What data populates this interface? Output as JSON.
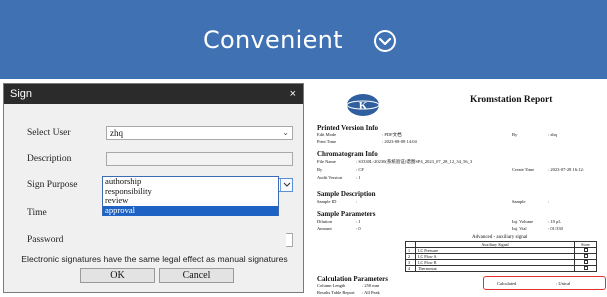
{
  "banner": {
    "title": "Convenient",
    "icon": "chevron-down-circle-icon",
    "background": "#3f71b3"
  },
  "dialog": {
    "title": "Sign",
    "close_icon": "×",
    "fields": {
      "select_user": {
        "label": "Select User",
        "value": "zhq"
      },
      "description": {
        "label": "Description",
        "value": ""
      },
      "sign_purpose": {
        "label": "Sign Purpose",
        "value": "authorship"
      },
      "time": {
        "label": "Time"
      },
      "password": {
        "label": "Password"
      }
    },
    "sign_purpose_options": [
      "authorship",
      "responsibility",
      "review",
      "approval"
    ],
    "highlighted_option": "approval",
    "note": "Electronic signatures have the same legal effect as manual signatures",
    "ok_label": "OK",
    "cancel_label": "Cancel"
  },
  "report": {
    "title": "Kromstation Report",
    "sections": {
      "printed": "Printed Version Info",
      "chromatogram": "Chromatogram Info",
      "sample_desc": "Sample Description",
      "sample_params": "Sample Parameters",
      "calc_params": "Calculation Parameters"
    },
    "printed_rows": [
      {
        "k": "Edit Mode",
        "v": "PDF文档"
      },
      {
        "k": "Print Time",
        "v": "2023-08-08 14:04"
      }
    ],
    "printed_by": {
      "k": "By",
      "v": "zhq"
    },
    "chrom_rows": [
      {
        "k": "File Name",
        "v": "S3330L-20230(系统验证)谱图SP4_2023_07_28_12_34_56_3"
      },
      {
        "k": "By",
        "v": "CF"
      },
      {
        "k": "Audit Version",
        "v": "1"
      }
    ],
    "create_time": {
      "k": "Create Time",
      "v": "2023-07-28 16:12:"
    },
    "sample_id": {
      "k": "Sample ID",
      "v": ""
    },
    "sample": {
      "k": "Sample",
      "v": ""
    },
    "dilution": {
      "k": "Dilution",
      "v": "1"
    },
    "amount": {
      "k": "Amount",
      "v": "0"
    },
    "inj_volume": {
      "k": "Inj. Volume",
      "v": "10 μL"
    },
    "inj_vial": {
      "k": "Inj. Vial",
      "v": "01/330"
    },
    "aux_title": "Advanced - auxiliary signal",
    "aux_header": [
      "Auxiliary Signal",
      "Store"
    ],
    "aux_rows": [
      {
        "n": "1",
        "name": "LC Pressure"
      },
      {
        "n": "2",
        "name": "LC Flow A"
      },
      {
        "n": "3",
        "name": "LC Flow B"
      },
      {
        "n": "4",
        "name": "Thermostat"
      }
    ],
    "column_length": {
      "k": "Column Length",
      "v": "250 mm"
    },
    "results_table": {
      "k": "Results Table Report",
      "v": "All Peak"
    },
    "calculated": "Calculated",
    "calc_value": "Unical",
    "highlight_color": "#e53030"
  }
}
